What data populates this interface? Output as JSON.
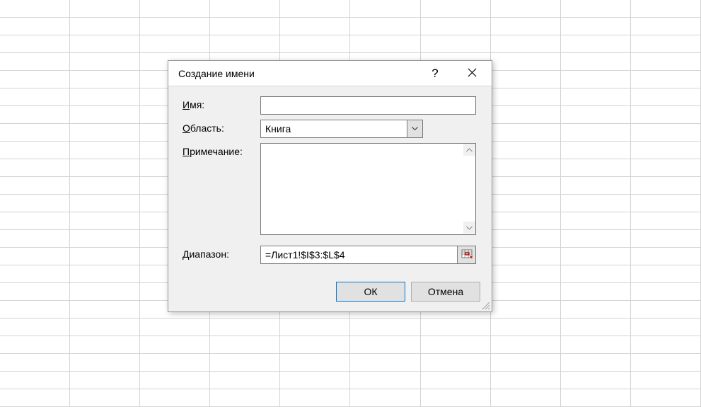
{
  "dialog": {
    "title": "Создание имени",
    "labels": {
      "name": "Имя:",
      "name_hotkey": "И",
      "scope": "Область:",
      "scope_hotkey": "О",
      "comment": "Примечание:",
      "comment_hotkey": "П",
      "range": "Диапазон:"
    },
    "fields": {
      "name_value": "",
      "scope_value": "Книга",
      "comment_value": "",
      "range_value": "=Лист1!$I$3:$L$4"
    },
    "buttons": {
      "ok": "ОК",
      "cancel": "Отмена"
    }
  }
}
